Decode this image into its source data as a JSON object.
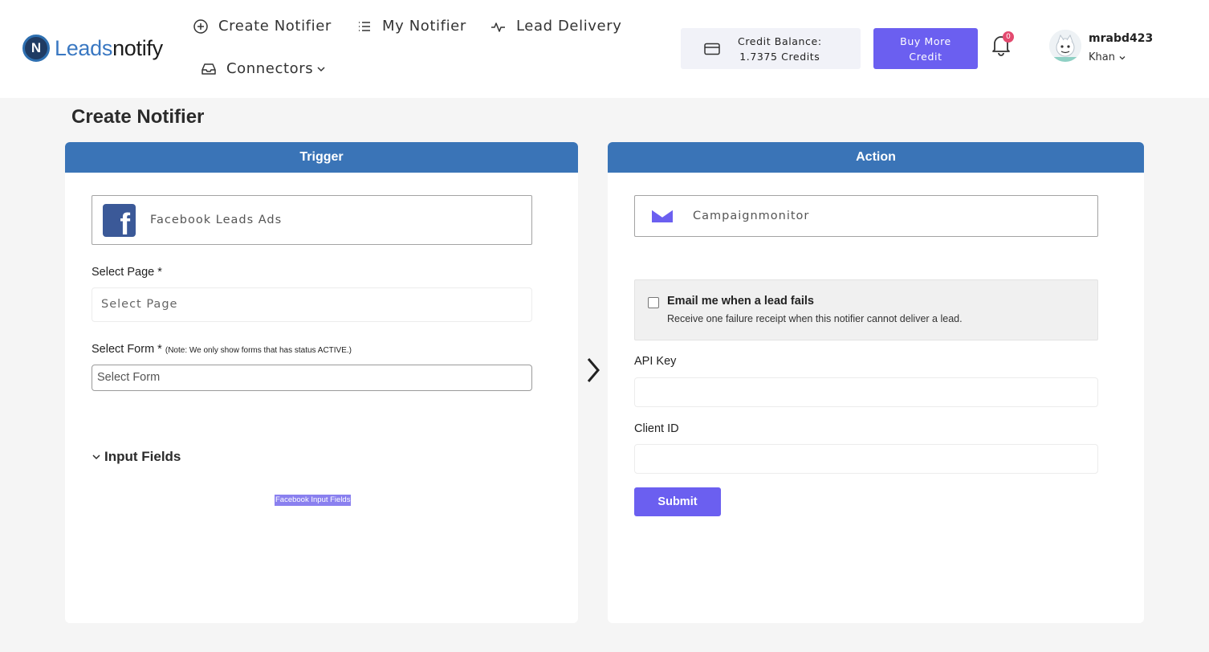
{
  "brand": {
    "name_part1": "Leads",
    "name_part2": "notify"
  },
  "nav": {
    "create_notifier": "Create Notifier",
    "my_notifier": "My Notifier",
    "lead_delivery": "Lead Delivery",
    "connectors": "Connectors"
  },
  "credit": {
    "line1": "Credit Balance:",
    "line2": "1.7375 Credits"
  },
  "buy": {
    "line1": "Buy More",
    "line2": "Credit"
  },
  "notifications": {
    "count": "0"
  },
  "user": {
    "name": "mrabd423",
    "sub": "Khan"
  },
  "page": {
    "title": "Create Notifier"
  },
  "trigger": {
    "header": "Trigger",
    "app_name": "Facebook Leads Ads",
    "select_page_label": "Select Page *",
    "select_page_placeholder": "Select Page",
    "select_form_label": "Select Form *",
    "select_form_note": "(Note: We only show forms that has status ACTIVE.)",
    "select_form_placeholder": "Select Form",
    "input_fields_label": "Input Fields",
    "input_fields_tag": "Facebook Input Fields"
  },
  "action": {
    "header": "Action",
    "app_name": "Campaignmonitor",
    "email_fail_title": "Email me when a lead fails",
    "email_fail_desc": "Receive one failure receipt when this notifier cannot deliver a lead.",
    "api_key_label": "API Key",
    "api_key_value": "",
    "client_id_label": "Client ID",
    "client_id_value": "",
    "submit_label": "Submit"
  },
  "colors": {
    "accent": "#6b5ff0",
    "panel_header": "#3a74b7",
    "facebook": "#3b5998",
    "badge": "#e34a6f"
  },
  "icons": {
    "create_notifier": "plus-circle-icon",
    "my_notifier": "list-icon",
    "lead_delivery": "activity-icon",
    "connectors": "inbox-icon",
    "credit": "credit-card-icon",
    "notifications": "bell-icon",
    "separator": "chevron-right-icon"
  }
}
